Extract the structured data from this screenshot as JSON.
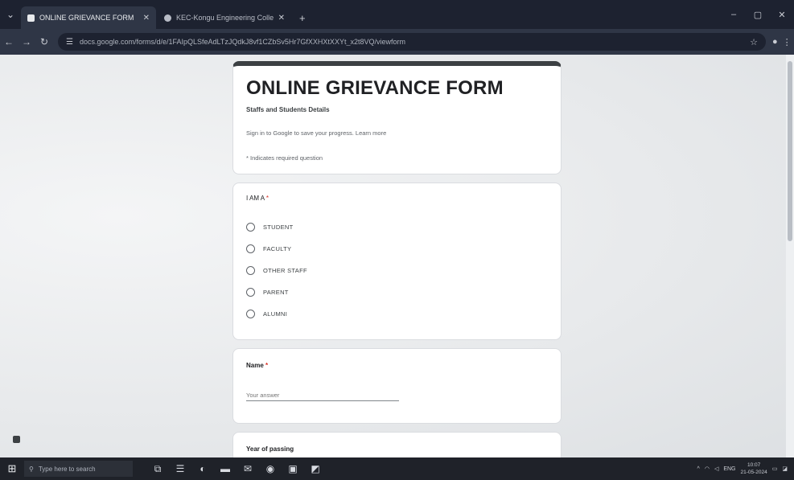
{
  "browser": {
    "tabs": [
      {
        "title": "ONLINE GRIEVANCE FORM",
        "active": true
      },
      {
        "title": "KEC-Kongu Engineering Colle...",
        "active": false
      }
    ],
    "new_tab": "+",
    "window_controls": {
      "minimize": "–",
      "restore": "▢",
      "close": "✕"
    },
    "url": "docs.google.com/forms/d/e/1FAIpQLSfeAdLTzJQdkJ8vf1CZbSv5Hr7GfXXHXtXXYt_x2t8VQ/viewform"
  },
  "form": {
    "title": "ONLINE GRIEVANCE FORM",
    "description": "Staffs and Students Details",
    "signin_text": "Sign in to Google to save your progress. Learn more",
    "required_note": "* Indicates required question",
    "question1": {
      "label": "I AM A",
      "required_mark": "*",
      "options": [
        "STUDENT",
        "FACULTY",
        "OTHER STAFF",
        "PARENT",
        "ALUMNI"
      ]
    },
    "name_question": {
      "label": "Name",
      "required_mark": "*",
      "placeholder": "Your answer"
    },
    "year_question": {
      "label": "Year of passing"
    }
  },
  "taskbar": {
    "search_placeholder": "Type here to search",
    "tray_text": "ENG",
    "time": "10:07",
    "date": "21-05-2024"
  }
}
